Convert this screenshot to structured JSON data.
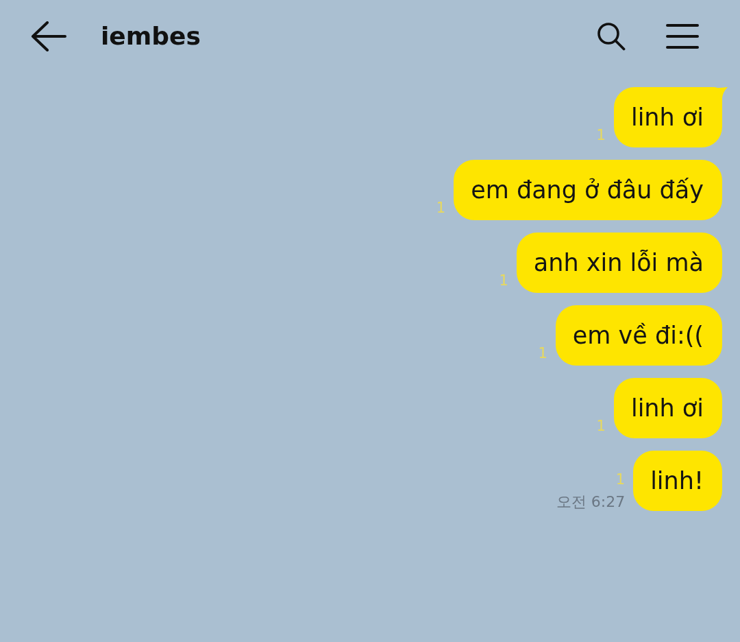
{
  "header": {
    "title": "iembes"
  },
  "messages": [
    {
      "text": "linh ơi",
      "unread": "1",
      "tail": true
    },
    {
      "text": "em đang ở đâu đấy",
      "unread": "1",
      "tail": false
    },
    {
      "text": "anh xin lỗi mà",
      "unread": "1",
      "tail": false
    },
    {
      "text": "em về đi:((",
      "unread": "1",
      "tail": false
    },
    {
      "text": "linh ơi",
      "unread": "1",
      "tail": false
    },
    {
      "text": "linh!",
      "unread": "1",
      "tail": false,
      "time": "오전 6:27"
    }
  ]
}
